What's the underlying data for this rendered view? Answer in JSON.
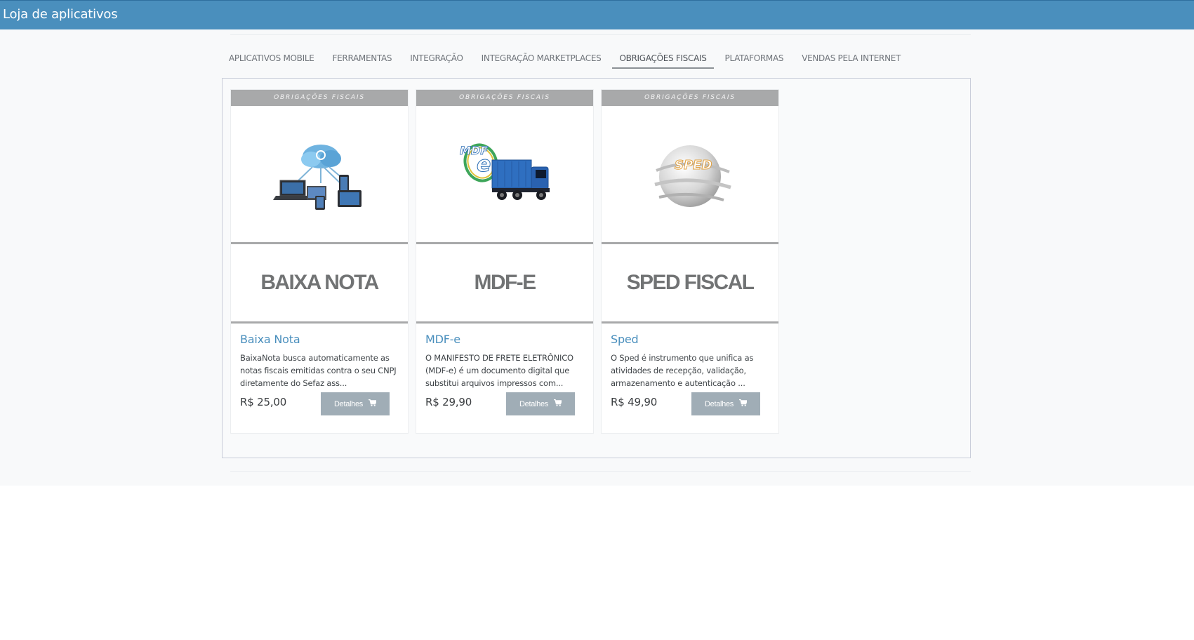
{
  "header": {
    "title": "Loja de aplicativos"
  },
  "tabs": [
    {
      "label": "APLICATIVOS MOBILE",
      "active": false
    },
    {
      "label": "FERRAMENTAS",
      "active": false
    },
    {
      "label": "INTEGRAÇÃO",
      "active": false
    },
    {
      "label": "INTEGRAÇÃO MARKETPLACES",
      "active": false
    },
    {
      "label": "OBRIGAÇÕES FISCAIS",
      "active": true
    },
    {
      "label": "PLATAFORMAS",
      "active": false
    },
    {
      "label": "VENDAS PELA INTERNET",
      "active": false
    }
  ],
  "cards": [
    {
      "category": "OBRIGAÇÕES FISCAIS",
      "image_icon": "cloud-devices-icon",
      "banner": "BAIXA NOTA",
      "name": "Baixa Nota",
      "description": "BaixaNota busca automaticamente as notas fiscais emitidas contra o seu CNPJ diretamente do Sefaz ass...",
      "price": "R$ 25,00",
      "button_label": "Detalhes"
    },
    {
      "category": "OBRIGAÇÕES FISCAIS",
      "image_icon": "mdfe-truck-icon",
      "banner": "MDF-E",
      "name": "MDF-e",
      "description": "O MANIFESTO DE FRETE ELETRÔNICO (MDF-e) é um documento digital que substitui arquivos impressos com...",
      "price": "R$ 29,90",
      "button_label": "Detalhes"
    },
    {
      "category": "OBRIGAÇÕES FISCAIS",
      "image_icon": "sped-globe-icon",
      "image_text": "SPED",
      "banner": "SPED FISCAL",
      "name": "Sped",
      "description": "O Sped é instrumento que unifica as atividades de recepção, validação, armazenamento e autenticação ...",
      "price": "R$ 49,90",
      "button_label": "Detalhes"
    }
  ],
  "colors": {
    "header_bg": "#4a8fbd",
    "link": "#4a8fbd",
    "button_bg": "#a0adb6",
    "category_bg": "#a8a9aa"
  }
}
